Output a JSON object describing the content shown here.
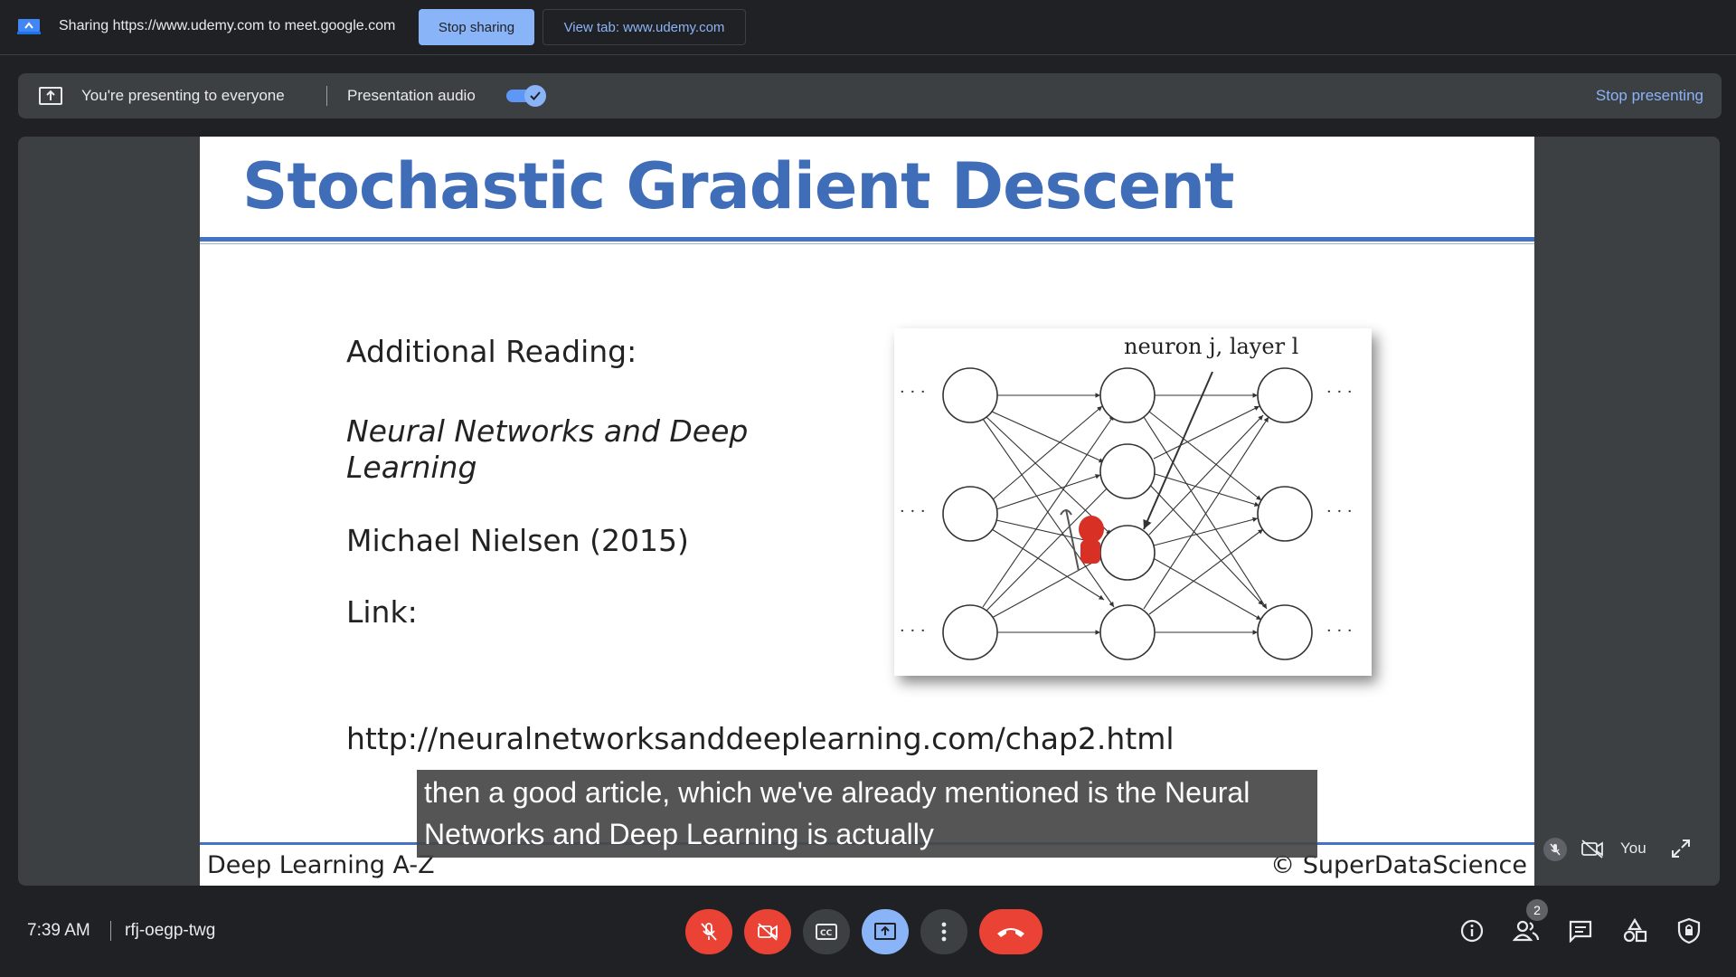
{
  "share_bar": {
    "message": "Sharing https://www.udemy.com to meet.google.com",
    "stop_sharing": "Stop sharing",
    "view_tab": "View tab: www.udemy.com"
  },
  "present_bar": {
    "message": "You're presenting to everyone",
    "audio_label": "Presentation audio",
    "audio_enabled": true,
    "stop_presenting": "Stop presenting"
  },
  "slide": {
    "title": "Stochastic Gradient Descent",
    "heading": "Additional Reading:",
    "book": "Neural Networks and Deep Learning",
    "author": "Michael Nielsen (2015)",
    "link_label": "Link:",
    "url": "http://neuralnetworksanddeeplearning.com/chap2.html",
    "figure_label": "neuron j, layer l",
    "figure_ellipsis": "· · ·",
    "footer_left": "Deep Learning A-Z",
    "footer_right": "© SuperDataScience"
  },
  "caption": {
    "line1": "then a good article, which we've already mentioned is the Neural",
    "line2": "Networks and Deep Learning is actually"
  },
  "self_tile": {
    "name": "You"
  },
  "bottom_bar": {
    "time": "7:39 AM",
    "meeting_code": "rfj-oegp-twg",
    "participants_count": "2"
  },
  "colors": {
    "accent": "#8ab4f8",
    "danger": "#ea4335",
    "slide_blue": "#3f6db8"
  }
}
